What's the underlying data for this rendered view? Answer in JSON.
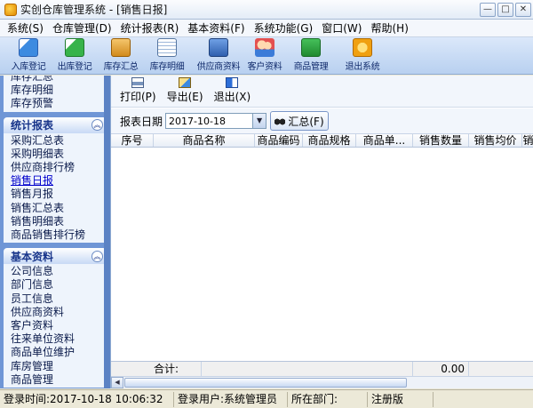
{
  "window": {
    "title": "实创仓库管理系统 - [销售日报]",
    "controls": {
      "minimize": "—",
      "maximize": "□",
      "close": "✕"
    }
  },
  "menu": [
    "系统(S)",
    "仓库管理(D)",
    "统计报表(R)",
    "基本资料(F)",
    "系统功能(G)",
    "窗口(W)",
    "帮助(H)"
  ],
  "toolbar": {
    "items": [
      {
        "label": "入库登记",
        "icon": "stock-in-icon"
      },
      {
        "label": "出库登记",
        "icon": "stock-out-icon"
      },
      {
        "label": "库存汇总",
        "icon": "stock-summary-icon"
      },
      {
        "label": "库存明细",
        "icon": "stock-detail-icon"
      },
      {
        "label": "供应商资料",
        "icon": "supplier-icon"
      },
      {
        "label": "客户资料",
        "icon": "customer-icon"
      },
      {
        "label": "商品管理",
        "icon": "goods-icon"
      },
      {
        "label": "退出系统",
        "icon": "exit-icon"
      }
    ]
  },
  "sidebar": {
    "top_items": [
      "库存汇总",
      "库存明细",
      "库存预警"
    ],
    "stats_section": {
      "title": "统计报表",
      "items": [
        "采购汇总表",
        "采购明细表",
        "供应商排行榜",
        "销售日报",
        "销售月报",
        "销售汇总表",
        "销售明细表",
        "商品销售排行榜"
      ],
      "active_index": 3
    },
    "basic_section": {
      "title": "基本资料",
      "items": [
        "公司信息",
        "部门信息",
        "员工信息",
        "供应商资料",
        "客户资料",
        "往来单位资料",
        "商品单位维护",
        "库房管理",
        "商品管理"
      ]
    }
  },
  "report": {
    "actions": {
      "print": "打印(P)",
      "export": "导出(E)",
      "quit": "退出(X)"
    },
    "filter": {
      "date_label": "报表日期",
      "date_value": "2017-10-18",
      "summary_button": "汇总(F)"
    },
    "columns": [
      "序号",
      "商品名称",
      "商品编码",
      "商品规格",
      "商品单...",
      "销售数量",
      "销售均价",
      "销"
    ],
    "rows": [],
    "footer": {
      "total_label": "合计:",
      "total_quantity": "0.00"
    }
  },
  "status": {
    "login_time": "登录时间:2017-10-18 10:06:32",
    "login_user": "登录用户:系统管理员",
    "department": "所在部门:",
    "registration": "注册版"
  }
}
